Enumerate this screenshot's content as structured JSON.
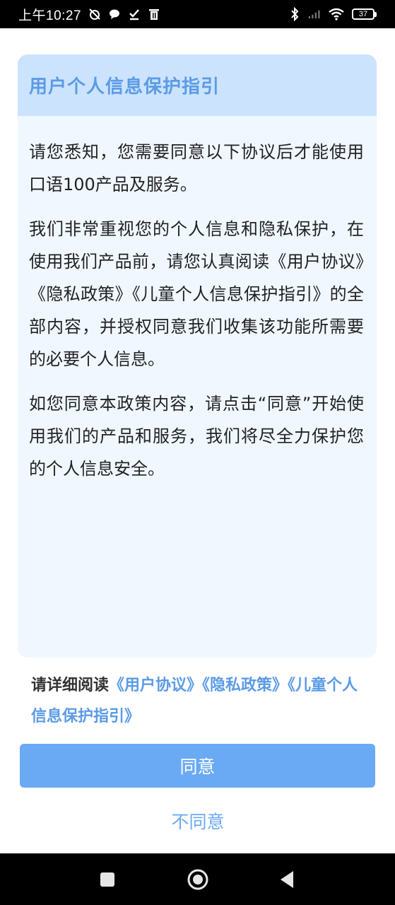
{
  "status_bar": {
    "time": "上午10:27",
    "battery": "37"
  },
  "dialog": {
    "title": "用户个人信息保护指引",
    "paragraphs": [
      "请您悉知，您需要同意以下协议后才能使用口语100产品及服务。",
      "我们非常重视您的个人信息和隐私保护，在使用我们产品前，请您认真阅读《用户协议》《隐私政策》《儿童个人信息保护指引》的全部内容，并授权同意我们收集该功能所需要的必要个人信息。",
      "如您同意本政策内容，请点击“同意”开始使用我们的产品和服务，我们将尽全力保护您的个人信息安全。"
    ]
  },
  "read_notice": {
    "prefix": "请详细阅读",
    "links": [
      "《用户协议》",
      "《隐私政策》",
      "《儿童个人信息保护指引》"
    ]
  },
  "buttons": {
    "agree": "同意",
    "disagree": "不同意"
  },
  "colors": {
    "accent": "#5b9be6",
    "button": "#6aaaf4",
    "header_bg": "#cce3fd",
    "card_bg": "#f0f7ff"
  }
}
